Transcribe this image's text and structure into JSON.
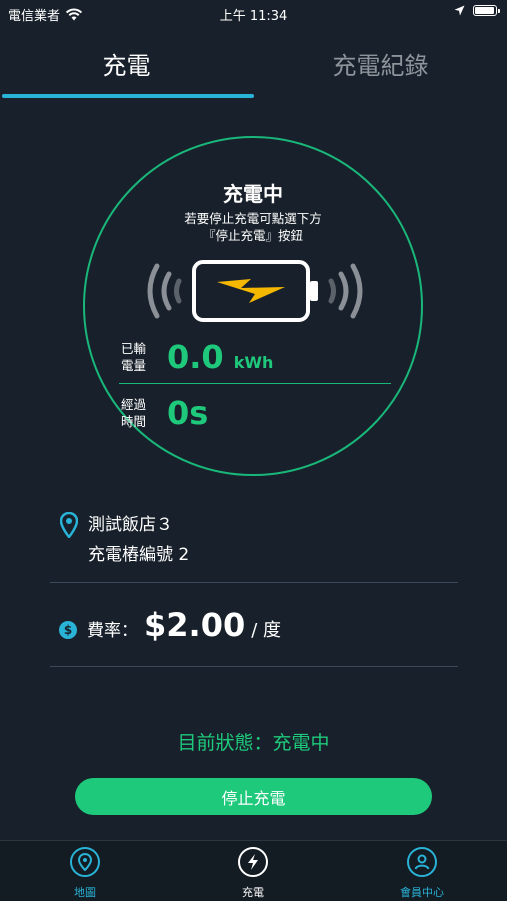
{
  "status_bar": {
    "carrier": "電信業者",
    "time": "上午 11:34"
  },
  "tabs": [
    {
      "label": "充電",
      "active": true
    },
    {
      "label": "充電紀錄",
      "active": false
    }
  ],
  "charging": {
    "title": "充電中",
    "hint_line1": "若要停止充電可點選下方",
    "hint_line2": "『停止充電』按鈕",
    "energy_label_line1": "已輸",
    "energy_label_line2": "電量",
    "energy_value": "0.0",
    "energy_unit": "kWh",
    "time_label_line1": "經過",
    "time_label_line2": "時間",
    "time_value": "0s"
  },
  "location": {
    "station": "測試飯店３",
    "charger": "充電樁編號 2"
  },
  "rate": {
    "icon_symbol": "$",
    "label": "費率：",
    "value": "$2.00",
    "unit": "/ 度"
  },
  "current_status": "目前狀態：充電中",
  "stop_button_label": "停止充電",
  "nav": [
    {
      "label": "地圖",
      "icon": "map-pin-icon"
    },
    {
      "label": "充電",
      "icon": "lightning-icon",
      "active": true
    },
    {
      "label": "會員中心",
      "icon": "user-icon"
    }
  ],
  "colors": {
    "background": "#18212b",
    "accent_green": "#1ec97b",
    "accent_blue": "#29b3d6",
    "battery_bolt": "#f5b800"
  }
}
